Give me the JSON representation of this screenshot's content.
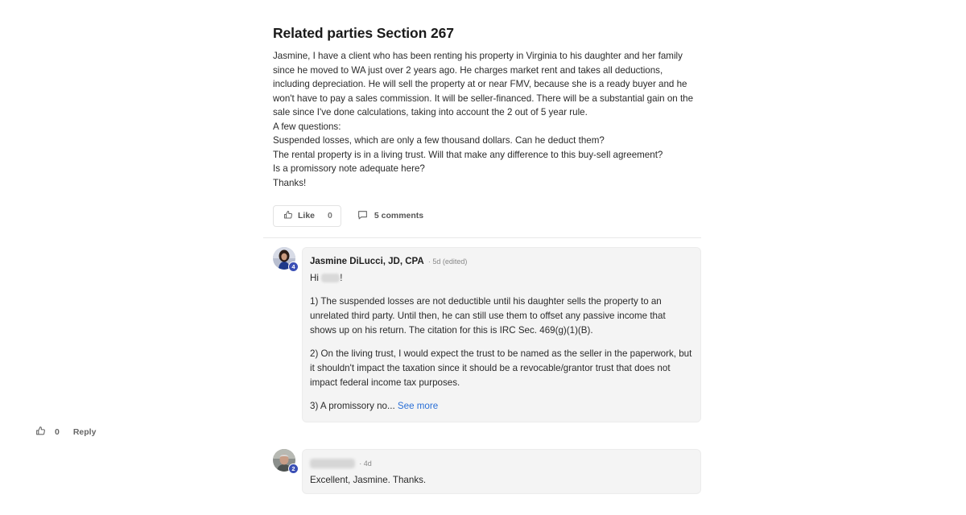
{
  "post": {
    "title": "Related parties Section 267",
    "body": [
      "Jasmine, I have a client who has been renting his property in Virginia to his daughter and her family since he moved to WA just over 2 years ago. He charges market rent and takes all deductions, including depreciation. He will sell the property at or near FMV, because she is a ready buyer and he won't have to pay a sales commission. It will be seller-financed. There will be a substantial gain on the sale since I've done calculations, taking into account the 2 out of 5 year rule.",
      "A few questions:",
      "Suspended losses, which are only a few thousand dollars. Can he deduct them?",
      "The rental property is in a living trust. Will that make any difference to this buy-sell agreement?",
      "Is a promissory note adequate here?",
      "Thanks!"
    ],
    "like_label": "Like",
    "like_count": "0",
    "comments_label": "5 comments"
  },
  "comments": [
    {
      "author": "Jasmine DiLucci, JD, CPA",
      "meta": "· 5d (edited)",
      "badge": "4",
      "greeting_prefix": "Hi",
      "greeting_suffix": "!",
      "paragraphs": [
        "1) The suspended losses are not deductible until his daughter sells the property to an unrelated third party. Until then, he can still use them to offset any passive income that shows up on his return. The citation for this is IRC Sec. 469(g)(1)(B).",
        "2) On the living trust, I would expect the trust to be named as the seller in the paperwork, but it shouldn't impact the taxation since it should be a revocable/grantor trust that does not impact federal income tax purposes."
      ],
      "truncated": "3) A promissory no...",
      "see_more": "See more",
      "like_count": "0",
      "reply_label": "Reply"
    },
    {
      "meta": "· 4d",
      "badge": "2",
      "body": "Excellent, Jasmine. Thanks."
    }
  ],
  "colors": {
    "accent": "#2a6fd6",
    "badge": "#3a4fb5",
    "bubble": "#f4f4f4"
  },
  "icons": [
    "thumbs-up-icon",
    "comment-icon"
  ]
}
